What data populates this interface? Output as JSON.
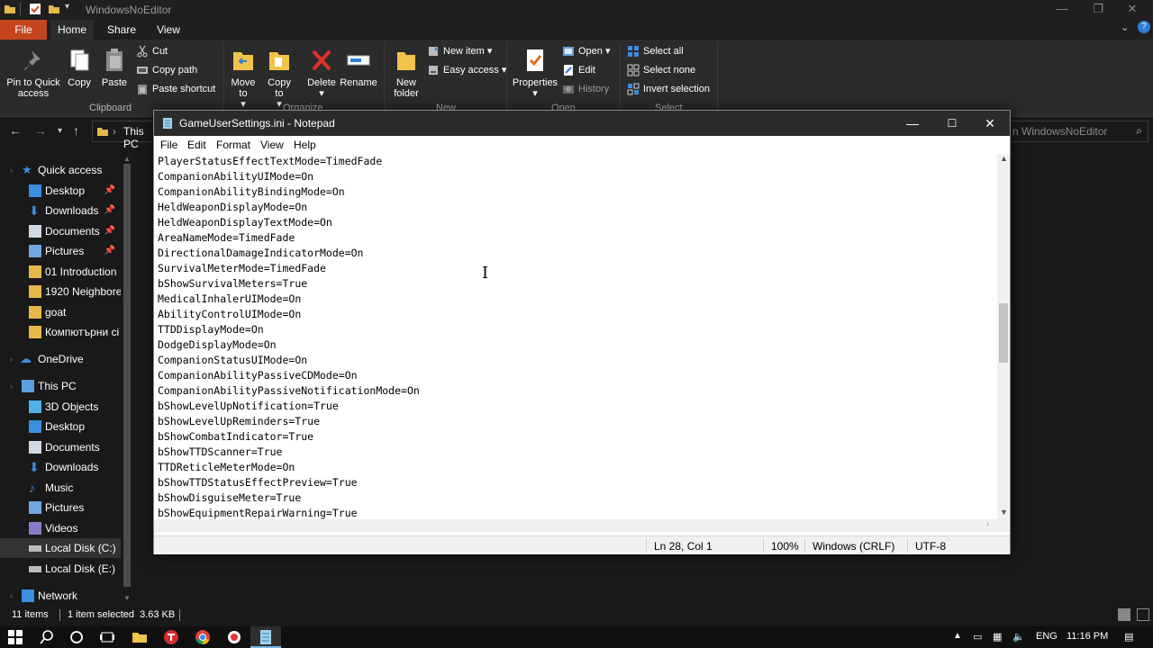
{
  "explorer": {
    "title": "WindowsNoEditor",
    "tabs": [
      "File",
      "Home",
      "Share",
      "View"
    ],
    "ribbon": {
      "pin_label": "Pin to Quick access",
      "copy_label": "Copy",
      "paste_label": "Paste",
      "cut_label": "Cut",
      "copy_path_label": "Copy path",
      "paste_shortcut_label": "Paste shortcut",
      "clipboard_group": "Clipboard",
      "move_to_label": "Move to",
      "copy_to_label": "Copy to",
      "delete_label": "Delete",
      "rename_label": "Rename",
      "organize_group": "Organize",
      "new_folder_label": "New folder",
      "new_item_label": "New item",
      "easy_access_label": "Easy access",
      "new_group": "New",
      "properties_label": "Properties",
      "open_label": "Open",
      "edit_label": "Edit",
      "history_label": "History",
      "open_group": "Open",
      "select_all_label": "Select all",
      "select_none_label": "Select none",
      "invert_selection_label": "Invert selection",
      "select_group": "Select"
    },
    "address": "This PC",
    "search_placeholder": "n WindowsNoEditor",
    "nav": {
      "quick_access": "Quick access",
      "items": [
        {
          "label": "Desktop",
          "pinned": true
        },
        {
          "label": "Downloads",
          "pinned": true
        },
        {
          "label": "Documents",
          "pinned": true
        },
        {
          "label": "Pictures",
          "pinned": true
        },
        {
          "label": "01 Introduction"
        },
        {
          "label": "1920 Neighbore"
        },
        {
          "label": "goat"
        },
        {
          "label": "Компютърни сі"
        }
      ],
      "onedrive": "OneDrive",
      "this_pc": "This PC",
      "pc_items": [
        {
          "label": "3D Objects"
        },
        {
          "label": "Desktop"
        },
        {
          "label": "Documents"
        },
        {
          "label": "Downloads"
        },
        {
          "label": "Music"
        },
        {
          "label": "Pictures"
        },
        {
          "label": "Videos"
        },
        {
          "label": "Local Disk (C:)"
        },
        {
          "label": "Local Disk (E:)"
        }
      ],
      "network": "Network"
    },
    "status": {
      "items_count": "11 items",
      "selection": "1 item selected  3.63 KB"
    }
  },
  "notepad": {
    "title": "GameUserSettings.ini - Notepad",
    "menu": [
      "File",
      "Edit",
      "Format",
      "View",
      "Help"
    ],
    "lines": [
      "PlayerStatusEffectTextMode=TimedFade",
      "CompanionAbilityUIMode=On",
      "CompanionAbilityBindingMode=On",
      "HeldWeaponDisplayMode=On",
      "HeldWeaponDisplayTextMode=On",
      "AreaNameMode=TimedFade",
      "DirectionalDamageIndicatorMode=On",
      "SurvivalMeterMode=TimedFade",
      "bShowSurvivalMeters=True",
      "MedicalInhalerUIMode=On",
      "AbilityControlUIMode=On",
      "TTDDisplayMode=On",
      "DodgeDisplayMode=On",
      "CompanionStatusUIMode=On",
      "CompanionAbilityPassiveCDMode=On",
      "CompanionAbilityPassiveNotificationMode=On",
      "bShowLevelUpNotification=True",
      "bShowLevelUpReminders=True",
      "bShowCombatIndicator=True",
      "bShowTTDScanner=True",
      "TTDReticleMeterMode=On",
      "bShowTTDStatusEffectPreview=True",
      "bShowDisguiseMeter=True",
      "bShowEquipmentRepairWarning=True"
    ],
    "status": {
      "position": "Ln 28, Col 1",
      "zoom": "100%",
      "line_ending": "Windows (CRLF)",
      "encoding": "UTF-8"
    }
  },
  "taskbar": {
    "language": "ENG",
    "time": "11:16 PM"
  }
}
